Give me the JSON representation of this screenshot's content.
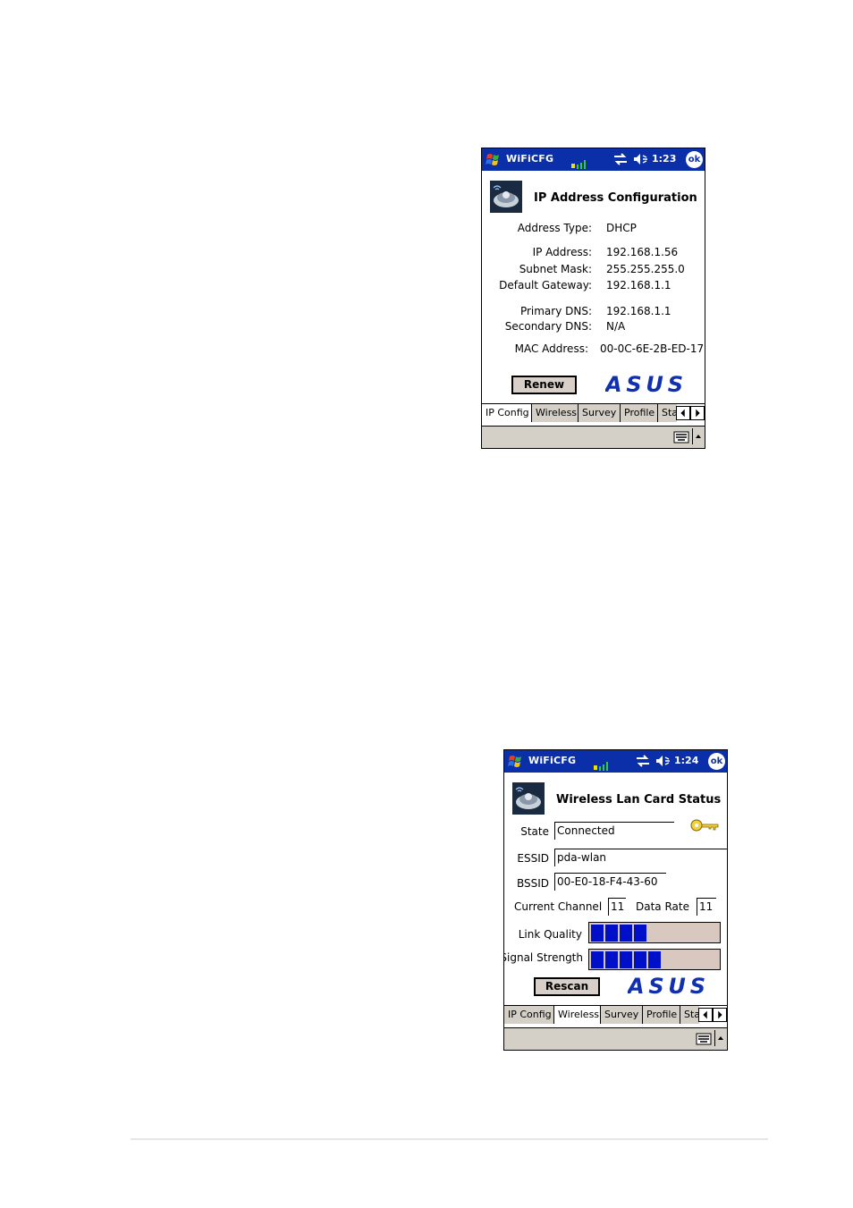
{
  "screens": [
    {
      "titlebar": {
        "app": "WiFiCFG",
        "time": "1:23",
        "ok": "ok"
      },
      "heading": "IP Address Configuration",
      "fields": [
        {
          "label": "Address Type:",
          "value": "DHCP"
        },
        {
          "label": "IP Address:",
          "value": "192.168.1.56"
        },
        {
          "label": "Subnet Mask:",
          "value": "255.255.255.0"
        },
        {
          "label": "Default Gateway:",
          "value": "192.168.1.1"
        },
        {
          "label": "Primary DNS:",
          "value": "192.168.1.1"
        },
        {
          "label": "Secondary DNS:",
          "value": "N/A"
        },
        {
          "label": "MAC Address:",
          "value": "00-0C-6E-2B-ED-17"
        }
      ],
      "button": "Renew",
      "logo": "ASUS",
      "tabs": [
        "IP Config",
        "Wireless",
        "Survey",
        "Profile",
        "Sta"
      ],
      "active_tab": "IP Config"
    },
    {
      "titlebar": {
        "app": "WiFiCFG",
        "time": "1:24",
        "ok": "ok"
      },
      "heading": "Wireless Lan Card Status",
      "state": {
        "label": "State",
        "value": "Connected"
      },
      "essid": {
        "label": "ESSID",
        "value": "pda-wlan"
      },
      "bssid": {
        "label": "BSSID",
        "value": "00-E0-18-F4-43-60"
      },
      "channel": {
        "label": "Current Channel",
        "value": "11"
      },
      "rate": {
        "label": "Data Rate",
        "value": "11"
      },
      "link_quality": {
        "label": "Link Quality",
        "level": 4,
        "max": 10
      },
      "signal_strength": {
        "label": "Signal Strength",
        "level": 5,
        "max": 10
      },
      "button": "Rescan",
      "logo": "ASUS",
      "tabs": [
        "IP Config",
        "Wireless",
        "Survey",
        "Profile",
        "Sta"
      ],
      "active_tab": "Wireless"
    }
  ],
  "icons": [
    "windows-start-icon",
    "signal-icon",
    "connectivity-icon",
    "speaker-icon",
    "wifi-app-icon",
    "key-icon",
    "keyboard-icon"
  ],
  "colors": {
    "titlebar": "#0a2fa8",
    "meter": "#0010c8",
    "logo": "#1030b0"
  }
}
